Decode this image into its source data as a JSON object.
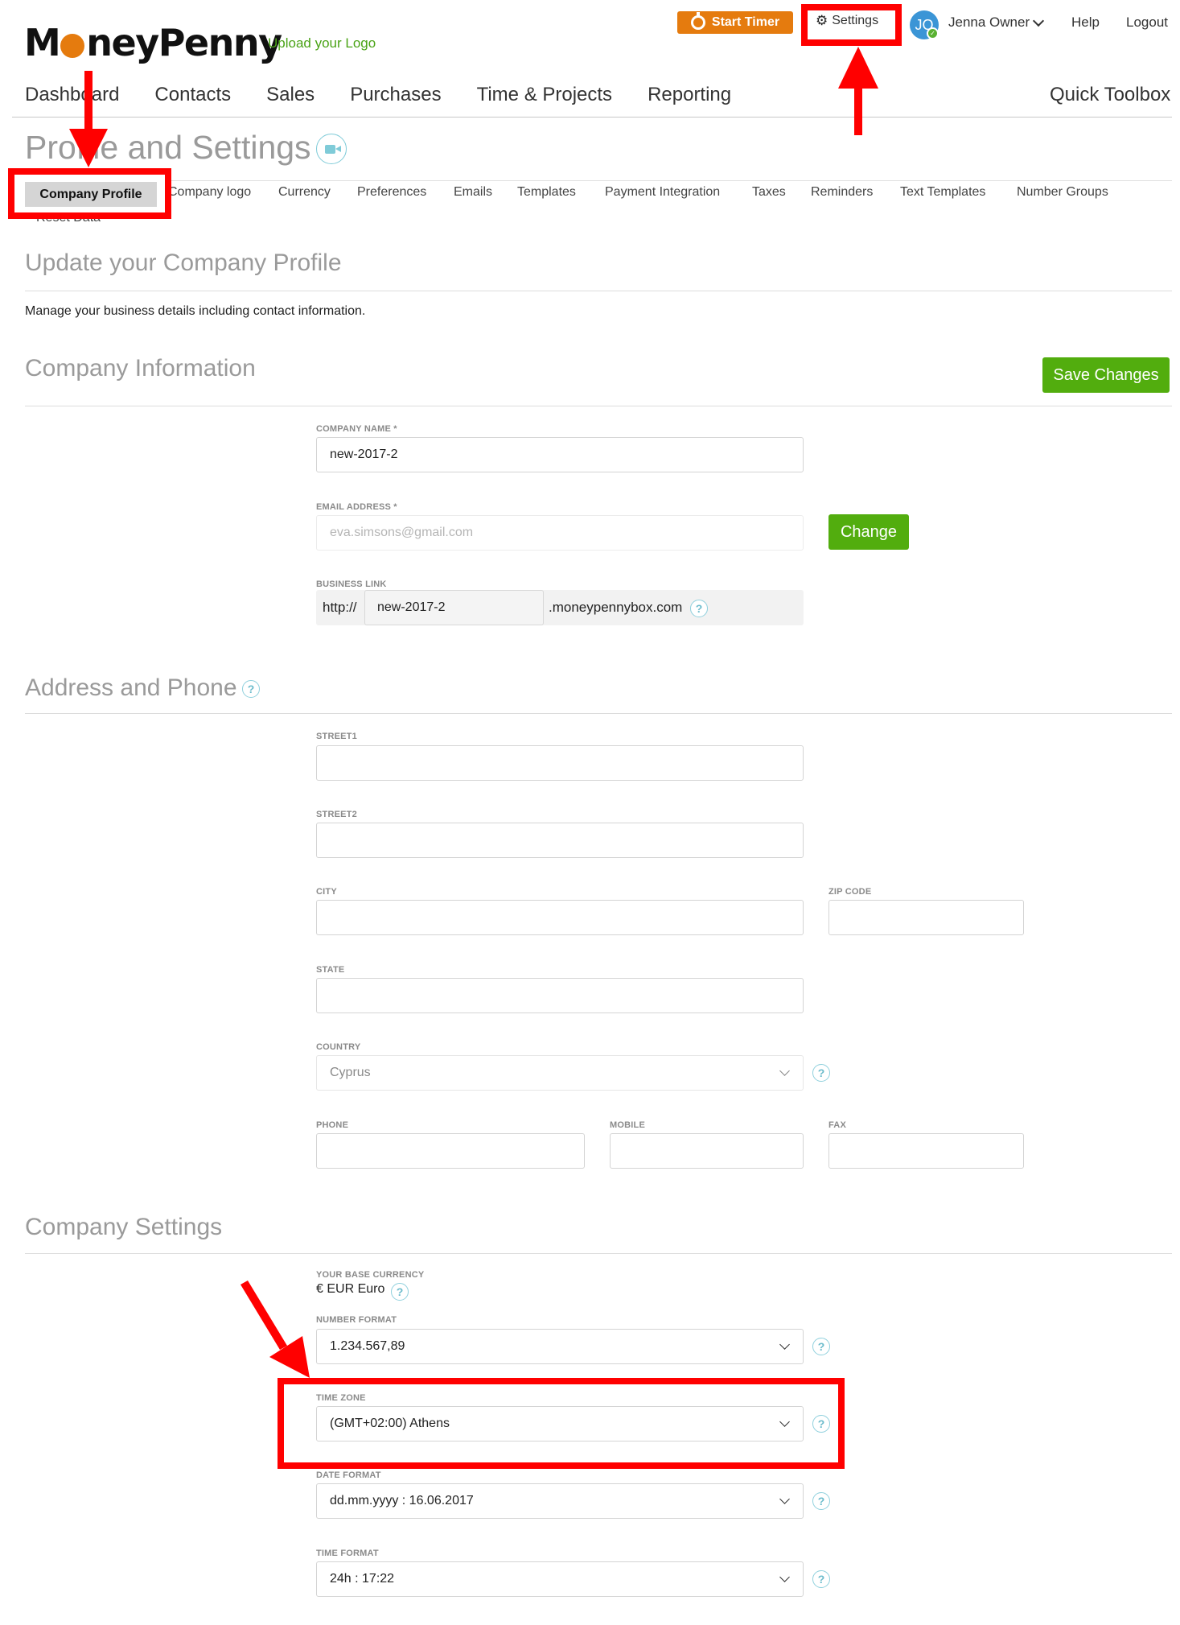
{
  "brand": {
    "logo_left": "M",
    "logo_right": "neyPenny",
    "upload_logo": "Upload your Logo",
    "accent_color": "#e57b0e",
    "primary_green": "#52ad0e"
  },
  "topbar": {
    "start_timer": "Start Timer",
    "settings": "Settings",
    "avatar_initials": "JO",
    "user_name": "Jenna Owner",
    "help": "Help",
    "logout": "Logout"
  },
  "main_nav": {
    "items": [
      "Dashboard",
      "Contacts",
      "Sales",
      "Purchases",
      "Time & Projects",
      "Reporting"
    ],
    "quick_toolbox": "Quick Toolbox"
  },
  "page": {
    "title": "Profile and Settings"
  },
  "settings_tabs": {
    "active": "Company Profile",
    "items": [
      "Company logo",
      "Currency",
      "Preferences",
      "Emails",
      "Templates",
      "Payment Integration",
      "Taxes",
      "Reminders",
      "Text Templates",
      "Number Groups"
    ],
    "second_row": "Reset Data"
  },
  "profile": {
    "heading": "Update your Company Profile",
    "description": "Manage your business details including contact information."
  },
  "company_info": {
    "heading": "Company Information",
    "save_button": "Save Changes",
    "company_name_label": "COMPANY NAME *",
    "company_name_value": "new-2017-2",
    "email_label": "EMAIL ADDRESS *",
    "email_value": "eva.simsons@gmail.com",
    "change_button": "Change",
    "business_link_label": "BUSINESS LINK",
    "business_link_prefix": "http://",
    "business_link_value": "new-2017-2",
    "business_link_suffix": ".moneypennybox.com"
  },
  "address": {
    "heading": "Address and Phone",
    "street1_label": "STREET1",
    "street1_value": "",
    "street2_label": "STREET2",
    "street2_value": "",
    "city_label": "CITY",
    "city_value": "",
    "zip_label": "ZIP CODE",
    "zip_value": "",
    "state_label": "STATE",
    "state_value": "",
    "country_label": "COUNTRY",
    "country_value": "Cyprus",
    "phone_label": "PHONE",
    "phone_value": "",
    "mobile_label": "MOBILE",
    "mobile_value": "",
    "fax_label": "FAX",
    "fax_value": ""
  },
  "company_settings": {
    "heading": "Company Settings",
    "base_currency_label": "YOUR BASE CURRENCY",
    "base_currency_value": "€ EUR Euro",
    "number_format_label": "NUMBER FORMAT",
    "number_format_value": "1.234.567,89",
    "time_zone_label": "TIME ZONE",
    "time_zone_value": "(GMT+02:00) Athens",
    "date_format_label": "DATE FORMAT",
    "date_format_value": "dd.mm.yyyy : 16.06.2017",
    "time_format_label": "TIME FORMAT",
    "time_format_value": "24h : 17:22"
  },
  "help_glyph": "?",
  "icons": {
    "settings": "gear-icon",
    "timer": "stopwatch-icon",
    "video": "video-camera-icon",
    "help": "question-circle-icon",
    "dropdown": "chevron-down-icon",
    "verified": "check-badge-icon"
  },
  "annotation_color": "#ff0000"
}
